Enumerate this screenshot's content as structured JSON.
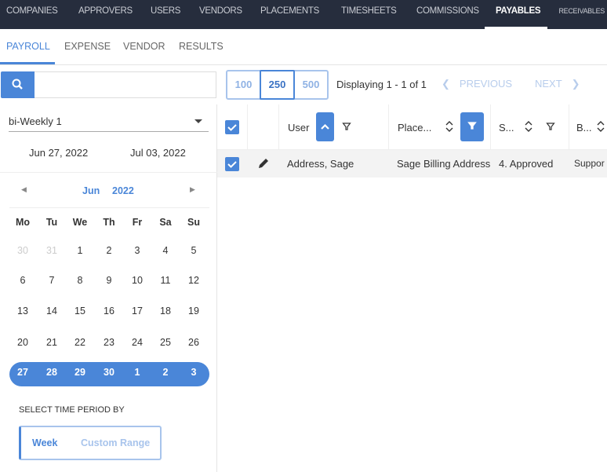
{
  "nav": {
    "items": [
      "COMPANIES",
      "APPROVERS",
      "USERS",
      "VENDORS",
      "PLACEMENTS",
      "TIMESHEETS",
      "COMMISSIONS",
      "PAYABLES",
      "RECEIVABLES"
    ],
    "active": "PAYABLES"
  },
  "subtabs": {
    "items": [
      "PAYROLL",
      "EXPENSE",
      "VENDOR",
      "RESULTS"
    ],
    "active": "PAYROLL"
  },
  "search": {
    "value": "",
    "placeholder": ""
  },
  "paging": {
    "sizes": [
      "100",
      "250",
      "500"
    ],
    "selected": "250",
    "display": "Displaying 1 - 1 of 1",
    "previous": "PREVIOUS",
    "next": "NEXT"
  },
  "period": {
    "select": "bi-Weekly 1",
    "start": "Jun 27, 2022",
    "end": "Jul 03, 2022"
  },
  "calendar": {
    "month": "Jun",
    "year": "2022",
    "weekdays": [
      "Mo",
      "Tu",
      "We",
      "Th",
      "Fr",
      "Sa",
      "Su"
    ],
    "weeks": [
      [
        "30",
        "31",
        "1",
        "2",
        "3",
        "4",
        "5"
      ],
      [
        "6",
        "7",
        "8",
        "9",
        "10",
        "11",
        "12"
      ],
      [
        "13",
        "14",
        "15",
        "16",
        "17",
        "18",
        "19"
      ],
      [
        "20",
        "21",
        "22",
        "23",
        "24",
        "25",
        "26"
      ],
      [
        "27",
        "28",
        "29",
        "30",
        "1",
        "2",
        "3"
      ]
    ],
    "selected_week": 4
  },
  "time_period": {
    "label": "SELECT TIME PERIOD BY",
    "options": [
      "Week",
      "Custom Range"
    ],
    "selected": "Week"
  },
  "grid": {
    "columns": [
      "User",
      "Place...",
      "S...",
      "B..."
    ],
    "rows": [
      {
        "user": "Address, Sage",
        "placement": "Sage Billing Address",
        "status": "4. Approved",
        "b": "Suppor"
      }
    ]
  },
  "colors": {
    "accent": "#4a86d8",
    "nav_bg": "#262d3d"
  }
}
